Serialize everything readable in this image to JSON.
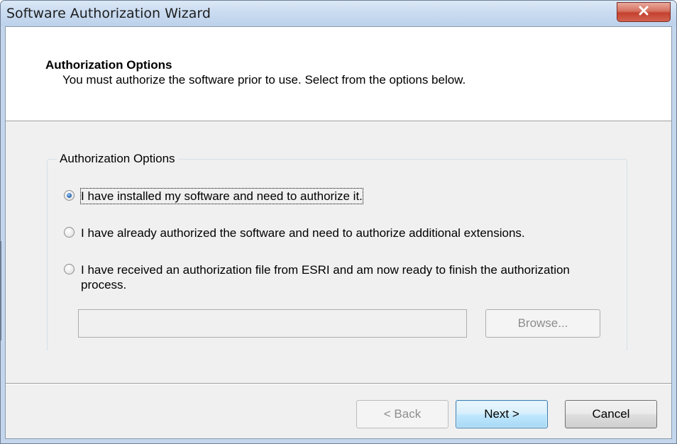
{
  "window": {
    "title": "Software Authorization Wizard",
    "close_icon": "close-x-icon"
  },
  "header": {
    "title": "Authorization Options",
    "subtitle": "You must authorize the software prior to use. Select from the options below."
  },
  "group": {
    "label": "Authorization Options",
    "options": [
      {
        "label": "I have installed my software and need to authorize it.",
        "checked": true
      },
      {
        "label": "I have already authorized the software and need to authorize additional extensions.",
        "checked": false
      },
      {
        "label": "I have received an authorization file from ESRI and am now ready to finish the authorization process.",
        "checked": false
      }
    ],
    "file_path_value": "",
    "browse_label": "Browse..."
  },
  "footer": {
    "back_label": "< Back",
    "next_label": "Next >",
    "cancel_label": "Cancel"
  },
  "colors": {
    "close_button": "#c4412f",
    "next_button_border": "#3c7fb1"
  }
}
